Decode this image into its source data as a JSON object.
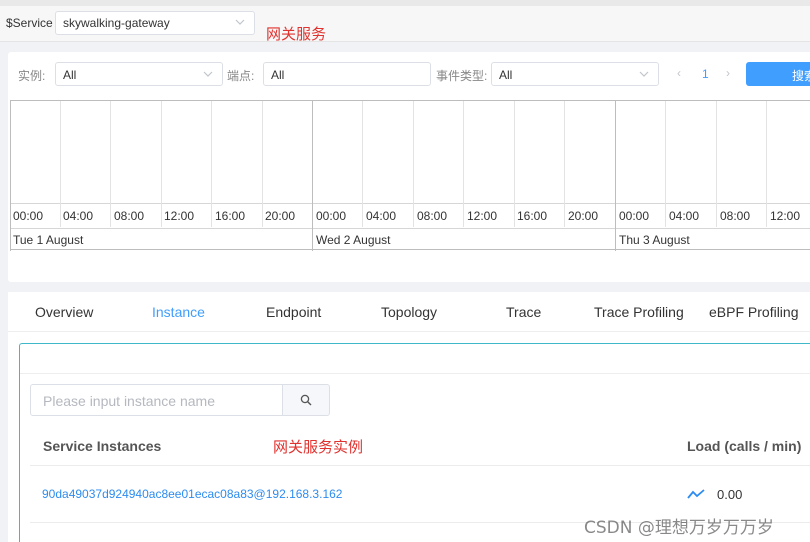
{
  "service_bar": {
    "label": "$Service",
    "selected": "skywalking-gateway",
    "note": "网关服务"
  },
  "events": {
    "instance_label": "实例:",
    "instance_value": "All",
    "endpoint_label": "端点:",
    "endpoint_value": "All",
    "type_label": "事件类型:",
    "type_value": "All",
    "pager_prev": "‹",
    "pager_page": "1",
    "pager_next": "›",
    "search_label": "搜索",
    "hours": [
      "00:00",
      "04:00",
      "08:00",
      "12:00",
      "16:00",
      "20:00"
    ],
    "days": [
      "Tue 1 August",
      "Wed 2 August",
      "Thu 3 August"
    ]
  },
  "tabs": [
    "Overview",
    "Instance",
    "Endpoint",
    "Topology",
    "Trace",
    "Trace Profiling",
    "eBPF Profiling"
  ],
  "active_tab": "Instance",
  "instances": {
    "search_placeholder": "Please input instance name",
    "col_service": "Service Instances",
    "note": "网关服务实例",
    "col_load": "Load (calls / min)",
    "rows": [
      {
        "name": "90da49037d924940ac8ee01ecac08a83@192.168.3.162",
        "load": "0.00"
      }
    ]
  },
  "watermark": "CSDN @理想万岁万万岁",
  "colors": {
    "accent": "#409eff",
    "note_red": "#e0322e",
    "panel_border": "#3fb8c9"
  }
}
